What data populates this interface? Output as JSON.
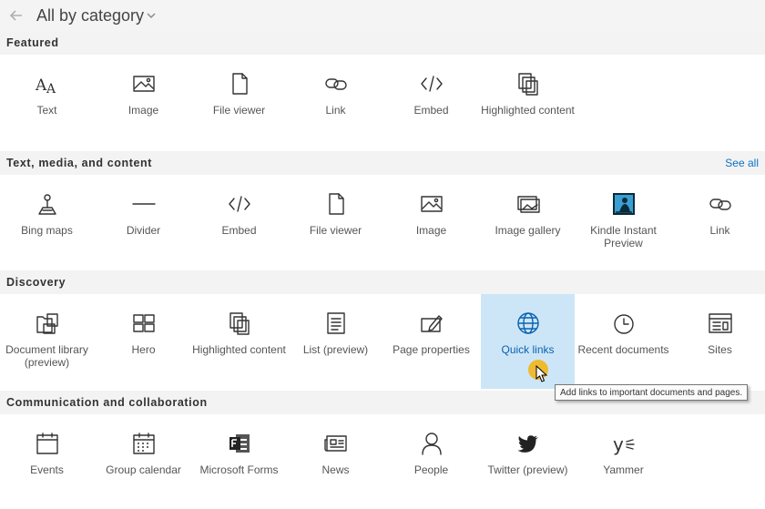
{
  "header": {
    "title": "All by category"
  },
  "sections": [
    {
      "title": "Featured",
      "see_all": "",
      "items": [
        {
          "label": "Text",
          "icon": "text-icon"
        },
        {
          "label": "Image",
          "icon": "image-icon"
        },
        {
          "label": "File viewer",
          "icon": "file-icon"
        },
        {
          "label": "Link",
          "icon": "link-icon"
        },
        {
          "label": "Embed",
          "icon": "embed-icon"
        },
        {
          "label": "Highlighted content",
          "icon": "highlighted-content-icon"
        }
      ]
    },
    {
      "title": "Text, media, and content",
      "see_all": "See all",
      "items": [
        {
          "label": "Bing maps",
          "icon": "bing-maps-icon"
        },
        {
          "label": "Divider",
          "icon": "divider-icon"
        },
        {
          "label": "Embed",
          "icon": "embed-icon"
        },
        {
          "label": "File viewer",
          "icon": "file-icon"
        },
        {
          "label": "Image",
          "icon": "image-icon"
        },
        {
          "label": "Image gallery",
          "icon": "image-gallery-icon"
        },
        {
          "label": "Kindle Instant Preview",
          "icon": "kindle-icon"
        },
        {
          "label": "Link",
          "icon": "link-icon"
        }
      ]
    },
    {
      "title": "Discovery",
      "see_all": "",
      "items": [
        {
          "label": "Document library (preview)",
          "icon": "document-library-icon"
        },
        {
          "label": "Hero",
          "icon": "hero-icon"
        },
        {
          "label": "Highlighted content",
          "icon": "highlighted-content-icon"
        },
        {
          "label": "List (preview)",
          "icon": "list-icon"
        },
        {
          "label": "Page properties",
          "icon": "page-properties-icon"
        },
        {
          "label": "Quick links",
          "icon": "globe-icon"
        },
        {
          "label": "Recent documents",
          "icon": "clock-icon"
        },
        {
          "label": "Sites",
          "icon": "sites-icon"
        }
      ]
    },
    {
      "title": "Communication and collaboration",
      "see_all": "",
      "items": [
        {
          "label": "Events",
          "icon": "calendar-icon"
        },
        {
          "label": "Group calendar",
          "icon": "group-calendar-icon"
        },
        {
          "label": "Microsoft Forms",
          "icon": "forms-icon"
        },
        {
          "label": "News",
          "icon": "news-icon"
        },
        {
          "label": "People",
          "icon": "person-icon"
        },
        {
          "label": "Twitter (preview)",
          "icon": "twitter-icon"
        },
        {
          "label": "Yammer",
          "icon": "yammer-icon"
        }
      ]
    }
  ],
  "tooltip": "Add links to important documents and pages.",
  "colors": {
    "accent": "#0b72c4",
    "selected_bg": "#cde6f7",
    "header_bg": "#f3f3f3",
    "cursor": "#f2b519"
  }
}
